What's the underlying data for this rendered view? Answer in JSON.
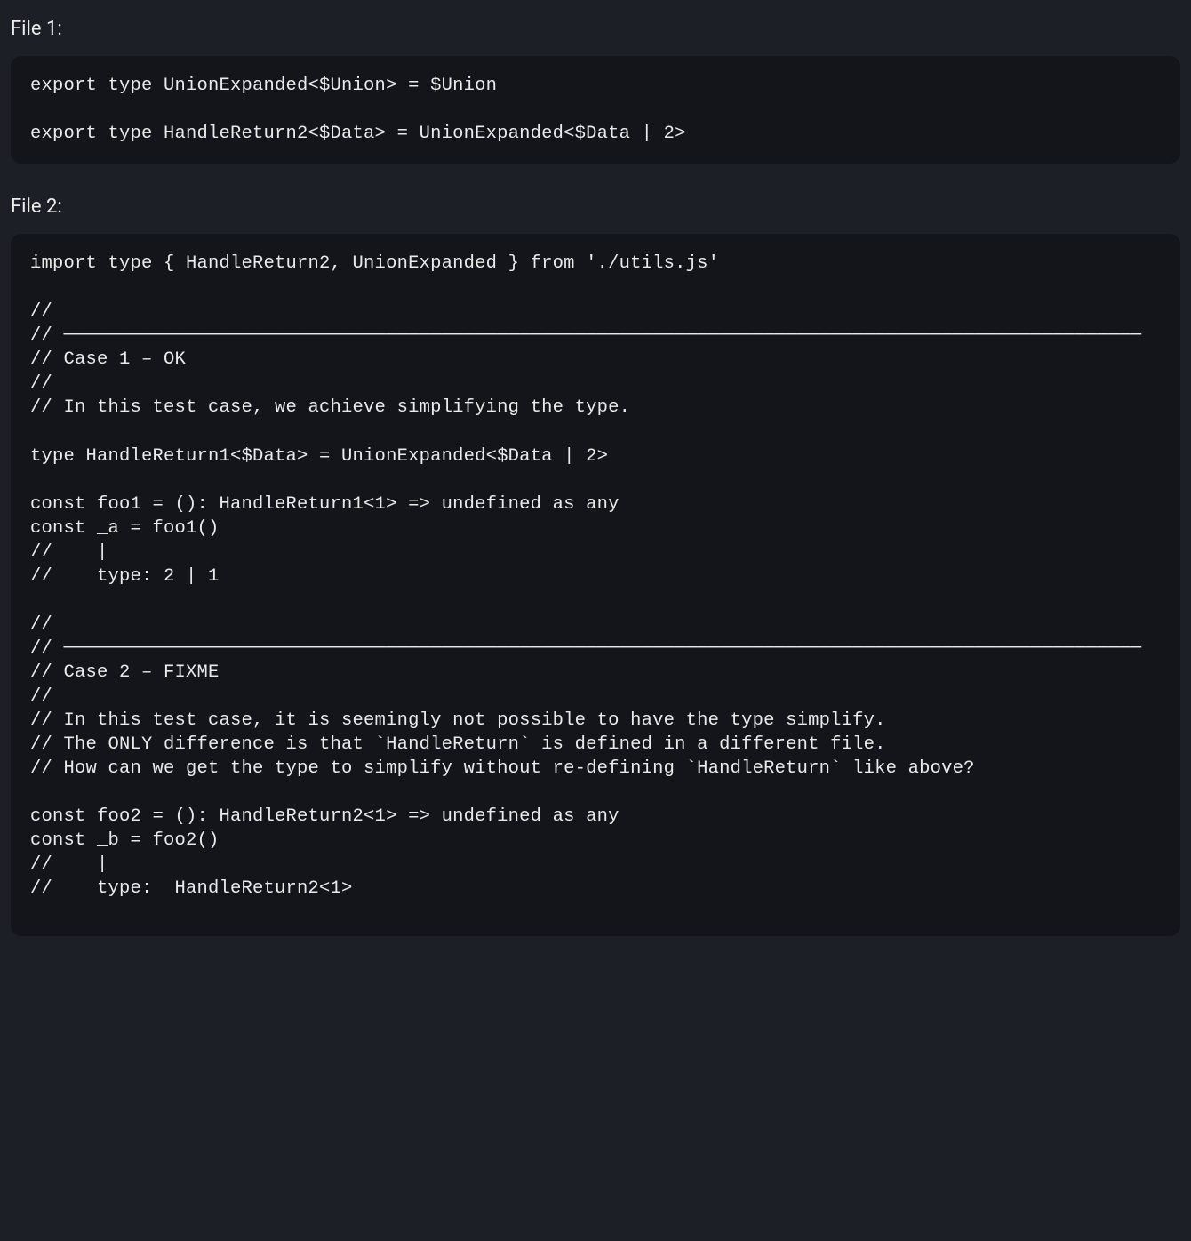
{
  "file1": {
    "label": "File 1:",
    "code": "export type UnionExpanded<$Union> = $Union\n\nexport type HandleReturn2<$Data> = UnionExpanded<$Data | 2>"
  },
  "file2": {
    "label": "File 2:",
    "code": "import type { HandleReturn2, UnionExpanded } from './utils.js'\n\n//\n// ─────────────────────────────────────────────────────────────────────────────────────────────────\n// Case 1 – OK\n//\n// In this test case, we achieve simplifying the type.\n\ntype HandleReturn1<$Data> = UnionExpanded<$Data | 2>\n\nconst foo1 = (): HandleReturn1<1> => undefined as any\nconst _a = foo1()\n//    |\n//    type: 2 | 1\n\n//\n// ─────────────────────────────────────────────────────────────────────────────────────────────────\n// Case 2 – FIXME\n//\n// In this test case, it is seemingly not possible to have the type simplify.\n// The ONLY difference is that `HandleReturn` is defined in a different file.\n// How can we get the type to simplify without re-defining `HandleReturn` like above?\n\nconst foo2 = (): HandleReturn2<1> => undefined as any\nconst _b = foo2()\n//    |\n//    type:  HandleReturn2<1>\n"
  }
}
